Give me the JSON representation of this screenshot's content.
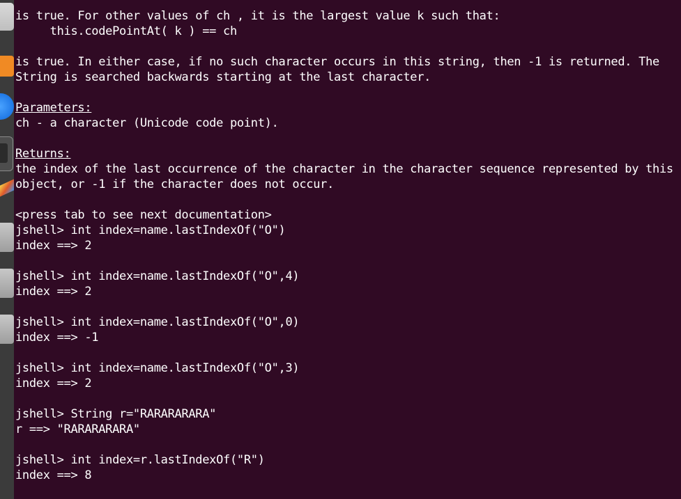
{
  "terminal": {
    "lines": [
      "is true. For other values of ch , it is the largest value k such that:",
      "     this.codePointAt( k ) == ch",
      "",
      "is true. In either case, if no such character occurs in this string, then -1 is returned. The",
      "String is searched backwards starting at the last character.",
      "",
      "Parameters:",
      "ch - a character (Unicode code point).",
      "",
      "Returns:",
      "the index of the last occurrence of the character in the character sequence represented by this",
      "object, or -1 if the character does not occur.",
      "",
      "<press tab to see next documentation>",
      "jshell> int index=name.lastIndexOf(\"O\")",
      "index ==> 2",
      "",
      "jshell> int index=name.lastIndexOf(\"O\",4)",
      "index ==> 2",
      "",
      "jshell> int index=name.lastIndexOf(\"O\",0)",
      "index ==> -1",
      "",
      "jshell> int index=name.lastIndexOf(\"O\",3)",
      "index ==> 2",
      "",
      "jshell> String r=\"RARARARARA\"",
      "r ==> \"RARARARARA\"",
      "",
      "jshell> int index=r.lastIndexOf(\"R\")",
      "index ==> 8"
    ]
  },
  "dock": {
    "items": [
      "files-icon",
      "app-icon-orange",
      "browser-icon",
      "terminal-icon",
      "text-editor-icon",
      "app-icon-grey",
      "app-icon-grey",
      "app-icon-grey"
    ]
  },
  "colors": {
    "background": "#300a24",
    "text": "#ffffff",
    "dock": "#3b3b3b"
  }
}
